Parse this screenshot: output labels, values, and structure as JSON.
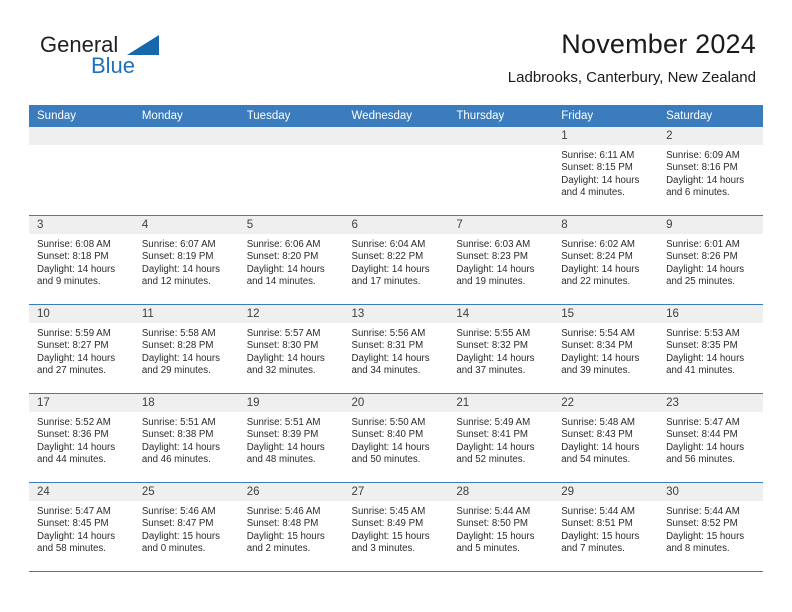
{
  "brand": {
    "name_part1": "General",
    "name_part2": "Blue",
    "logo_icon": "triangle-icon"
  },
  "header": {
    "title": "November 2024",
    "subtitle": "Ladbrooks, Canterbury, New Zealand"
  },
  "colors": {
    "header_blue": "#3a7cbe",
    "brand_blue": "#1f72b8",
    "daystrip_gray": "#efefef"
  },
  "calendar": {
    "weekday_headers": [
      "Sunday",
      "Monday",
      "Tuesday",
      "Wednesday",
      "Thursday",
      "Friday",
      "Saturday"
    ],
    "weeks": [
      [
        {
          "day": "",
          "empty": true
        },
        {
          "day": "",
          "empty": true
        },
        {
          "day": "",
          "empty": true
        },
        {
          "day": "",
          "empty": true
        },
        {
          "day": "",
          "empty": true
        },
        {
          "day": "1",
          "sunrise": "Sunrise: 6:11 AM",
          "sunset": "Sunset: 8:15 PM",
          "daylight": "Daylight: 14 hours and 4 minutes."
        },
        {
          "day": "2",
          "sunrise": "Sunrise: 6:09 AM",
          "sunset": "Sunset: 8:16 PM",
          "daylight": "Daylight: 14 hours and 6 minutes."
        }
      ],
      [
        {
          "day": "3",
          "sunrise": "Sunrise: 6:08 AM",
          "sunset": "Sunset: 8:18 PM",
          "daylight": "Daylight: 14 hours and 9 minutes."
        },
        {
          "day": "4",
          "sunrise": "Sunrise: 6:07 AM",
          "sunset": "Sunset: 8:19 PM",
          "daylight": "Daylight: 14 hours and 12 minutes."
        },
        {
          "day": "5",
          "sunrise": "Sunrise: 6:06 AM",
          "sunset": "Sunset: 8:20 PM",
          "daylight": "Daylight: 14 hours and 14 minutes."
        },
        {
          "day": "6",
          "sunrise": "Sunrise: 6:04 AM",
          "sunset": "Sunset: 8:22 PM",
          "daylight": "Daylight: 14 hours and 17 minutes."
        },
        {
          "day": "7",
          "sunrise": "Sunrise: 6:03 AM",
          "sunset": "Sunset: 8:23 PM",
          "daylight": "Daylight: 14 hours and 19 minutes."
        },
        {
          "day": "8",
          "sunrise": "Sunrise: 6:02 AM",
          "sunset": "Sunset: 8:24 PM",
          "daylight": "Daylight: 14 hours and 22 minutes."
        },
        {
          "day": "9",
          "sunrise": "Sunrise: 6:01 AM",
          "sunset": "Sunset: 8:26 PM",
          "daylight": "Daylight: 14 hours and 25 minutes."
        }
      ],
      [
        {
          "day": "10",
          "sunrise": "Sunrise: 5:59 AM",
          "sunset": "Sunset: 8:27 PM",
          "daylight": "Daylight: 14 hours and 27 minutes."
        },
        {
          "day": "11",
          "sunrise": "Sunrise: 5:58 AM",
          "sunset": "Sunset: 8:28 PM",
          "daylight": "Daylight: 14 hours and 29 minutes."
        },
        {
          "day": "12",
          "sunrise": "Sunrise: 5:57 AM",
          "sunset": "Sunset: 8:30 PM",
          "daylight": "Daylight: 14 hours and 32 minutes."
        },
        {
          "day": "13",
          "sunrise": "Sunrise: 5:56 AM",
          "sunset": "Sunset: 8:31 PM",
          "daylight": "Daylight: 14 hours and 34 minutes."
        },
        {
          "day": "14",
          "sunrise": "Sunrise: 5:55 AM",
          "sunset": "Sunset: 8:32 PM",
          "daylight": "Daylight: 14 hours and 37 minutes."
        },
        {
          "day": "15",
          "sunrise": "Sunrise: 5:54 AM",
          "sunset": "Sunset: 8:34 PM",
          "daylight": "Daylight: 14 hours and 39 minutes."
        },
        {
          "day": "16",
          "sunrise": "Sunrise: 5:53 AM",
          "sunset": "Sunset: 8:35 PM",
          "daylight": "Daylight: 14 hours and 41 minutes."
        }
      ],
      [
        {
          "day": "17",
          "sunrise": "Sunrise: 5:52 AM",
          "sunset": "Sunset: 8:36 PM",
          "daylight": "Daylight: 14 hours and 44 minutes."
        },
        {
          "day": "18",
          "sunrise": "Sunrise: 5:51 AM",
          "sunset": "Sunset: 8:38 PM",
          "daylight": "Daylight: 14 hours and 46 minutes."
        },
        {
          "day": "19",
          "sunrise": "Sunrise: 5:51 AM",
          "sunset": "Sunset: 8:39 PM",
          "daylight": "Daylight: 14 hours and 48 minutes."
        },
        {
          "day": "20",
          "sunrise": "Sunrise: 5:50 AM",
          "sunset": "Sunset: 8:40 PM",
          "daylight": "Daylight: 14 hours and 50 minutes."
        },
        {
          "day": "21",
          "sunrise": "Sunrise: 5:49 AM",
          "sunset": "Sunset: 8:41 PM",
          "daylight": "Daylight: 14 hours and 52 minutes."
        },
        {
          "day": "22",
          "sunrise": "Sunrise: 5:48 AM",
          "sunset": "Sunset: 8:43 PM",
          "daylight": "Daylight: 14 hours and 54 minutes."
        },
        {
          "day": "23",
          "sunrise": "Sunrise: 5:47 AM",
          "sunset": "Sunset: 8:44 PM",
          "daylight": "Daylight: 14 hours and 56 minutes."
        }
      ],
      [
        {
          "day": "24",
          "sunrise": "Sunrise: 5:47 AM",
          "sunset": "Sunset: 8:45 PM",
          "daylight": "Daylight: 14 hours and 58 minutes."
        },
        {
          "day": "25",
          "sunrise": "Sunrise: 5:46 AM",
          "sunset": "Sunset: 8:47 PM",
          "daylight": "Daylight: 15 hours and 0 minutes."
        },
        {
          "day": "26",
          "sunrise": "Sunrise: 5:46 AM",
          "sunset": "Sunset: 8:48 PM",
          "daylight": "Daylight: 15 hours and 2 minutes."
        },
        {
          "day": "27",
          "sunrise": "Sunrise: 5:45 AM",
          "sunset": "Sunset: 8:49 PM",
          "daylight": "Daylight: 15 hours and 3 minutes."
        },
        {
          "day": "28",
          "sunrise": "Sunrise: 5:44 AM",
          "sunset": "Sunset: 8:50 PM",
          "daylight": "Daylight: 15 hours and 5 minutes."
        },
        {
          "day": "29",
          "sunrise": "Sunrise: 5:44 AM",
          "sunset": "Sunset: 8:51 PM",
          "daylight": "Daylight: 15 hours and 7 minutes."
        },
        {
          "day": "30",
          "sunrise": "Sunrise: 5:44 AM",
          "sunset": "Sunset: 8:52 PM",
          "daylight": "Daylight: 15 hours and 8 minutes."
        }
      ]
    ]
  }
}
